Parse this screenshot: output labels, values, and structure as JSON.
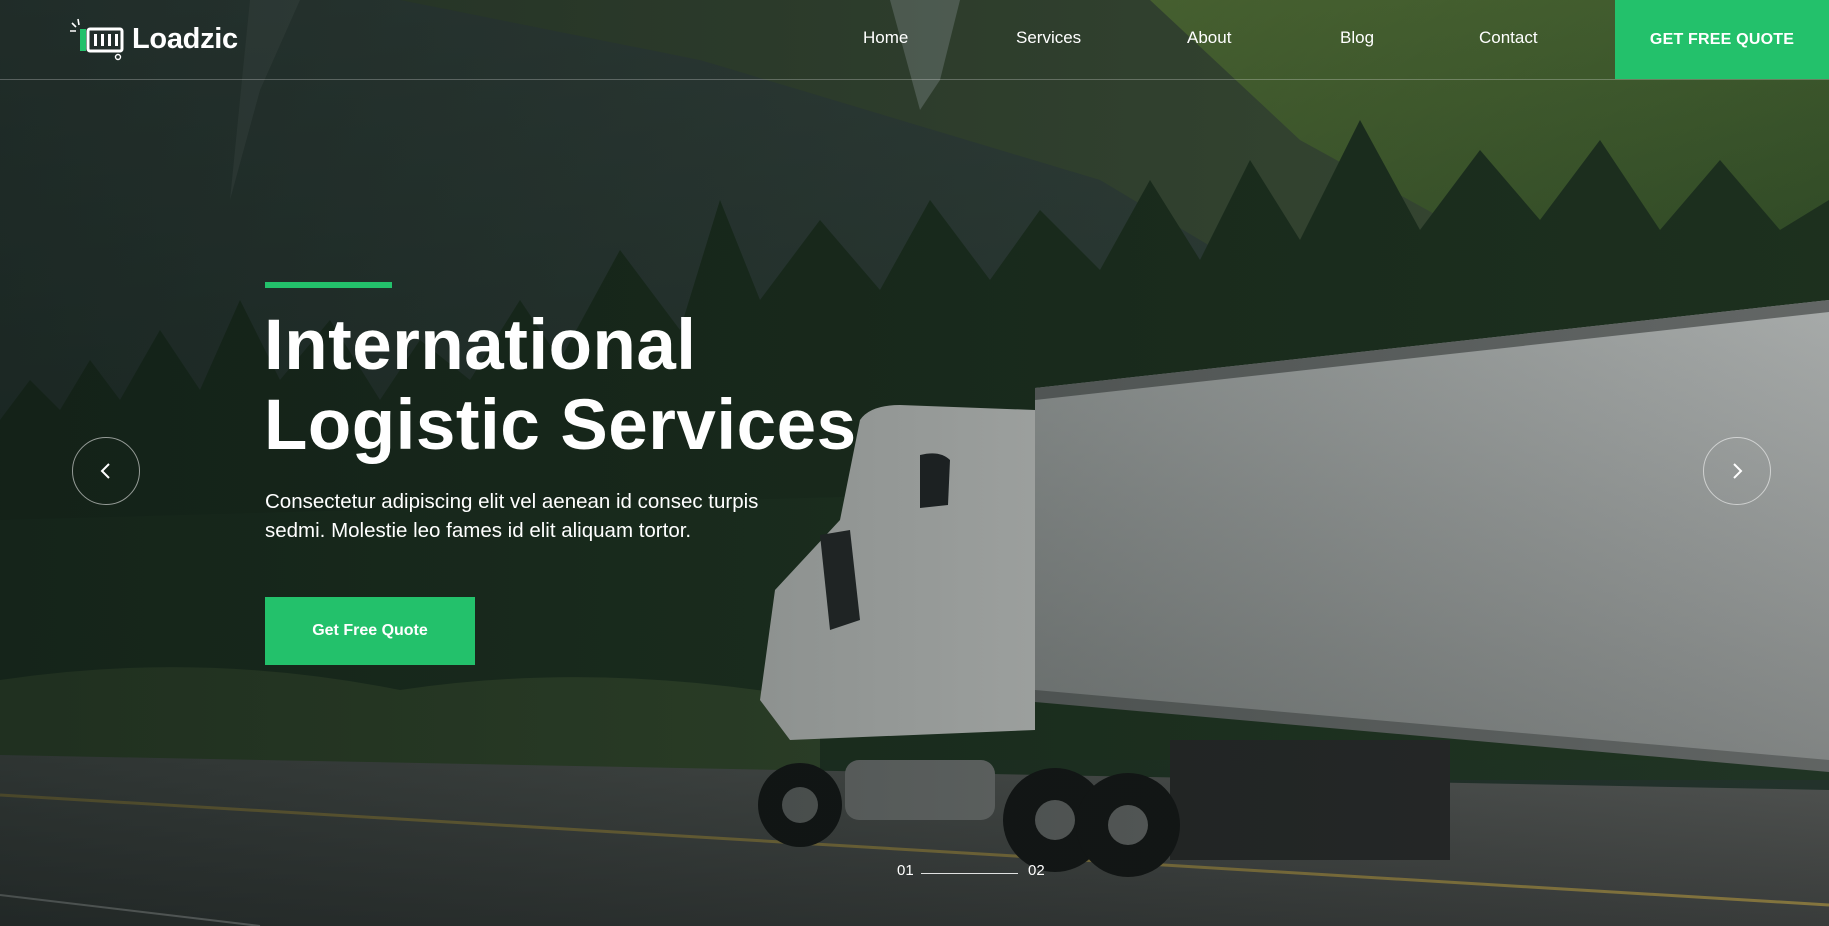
{
  "header": {
    "logo_text": "Loadzic",
    "nav": [
      "Home",
      "Services",
      "About",
      "Blog",
      "Contact"
    ],
    "cta_label": "GET FREE QUOTE"
  },
  "hero": {
    "title_line1": "International",
    "title_line2": "Logistic Services",
    "subtitle_line1": "Consectetur adipiscing elit vel aenean id consec turpis",
    "subtitle_line2": "sedmi. Molestie leo fames id elit aliquam tortor.",
    "cta_label": "Get Free Quote"
  },
  "slider": {
    "current": "01",
    "next": "02",
    "prev_icon": "chevron-left-icon",
    "next_icon": "chevron-right-icon"
  },
  "colors": {
    "accent": "#23c16b",
    "text": "#ffffff"
  },
  "background_image": "truck-on-mountain-highway"
}
